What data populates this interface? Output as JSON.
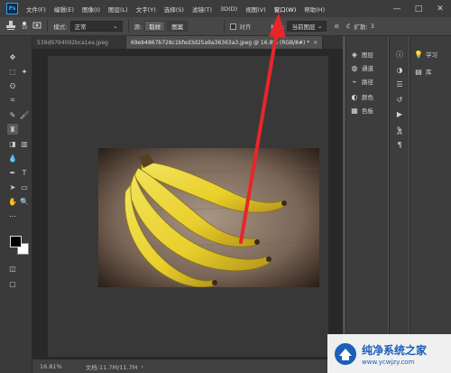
{
  "app": {
    "logo_text": "Ps",
    "menu": [
      {
        "label": "文件(F)"
      },
      {
        "label": "编辑(E)"
      },
      {
        "label": "图像(I)"
      },
      {
        "label": "图层(L)"
      },
      {
        "label": "文字(Y)"
      },
      {
        "label": "选择(S)"
      },
      {
        "label": "滤镜(T)"
      },
      {
        "label": "3D(D)"
      },
      {
        "label": "视图(V)"
      },
      {
        "label": "窗口(W)"
      },
      {
        "label": "帮助(H)"
      }
    ],
    "window_controls": {
      "minimize": "—",
      "maximize": "□",
      "close": "✕"
    }
  },
  "options": {
    "brush_size": "10",
    "mode_label": "模式:",
    "mode_value": "正常",
    "source_label": "源:",
    "source_btn1": "取样",
    "source_btn2": "图案",
    "align_label": "对齐",
    "sample_label": "样本:",
    "sample_value": "当前图层",
    "diffusion_label": "扩散:",
    "diffusion_value": "3"
  },
  "tabs": [
    {
      "label": "539d9794092bca1ea.jpeg"
    },
    {
      "label": "69eb4867b728c1bfed3d25a9a36363a3.jpeg @ 16.8% (RGB/8#) *"
    }
  ],
  "panels": {
    "col1": [
      {
        "label": "图层",
        "icon": "layers-icon"
      },
      {
        "label": "通道",
        "icon": "channels-icon"
      },
      {
        "label": "路径",
        "icon": "paths-icon"
      },
      {
        "label": "颜色",
        "icon": "color-icon"
      },
      {
        "label": "色板",
        "icon": "swatches-icon"
      }
    ],
    "col3": [
      {
        "label": "学习",
        "icon": "learn-icon"
      },
      {
        "label": "库",
        "icon": "libraries-icon"
      }
    ]
  },
  "status": {
    "zoom": "16.81%",
    "doc": "文档:11.7M/11.7M"
  },
  "watermark": {
    "title": "纯净系统之家",
    "url": "www.ycwjzy.com"
  },
  "colors": {
    "accent_arrow": "#e8262a",
    "ps_blue": "#31a8ff",
    "watermark_blue": "#1b5fb8"
  }
}
